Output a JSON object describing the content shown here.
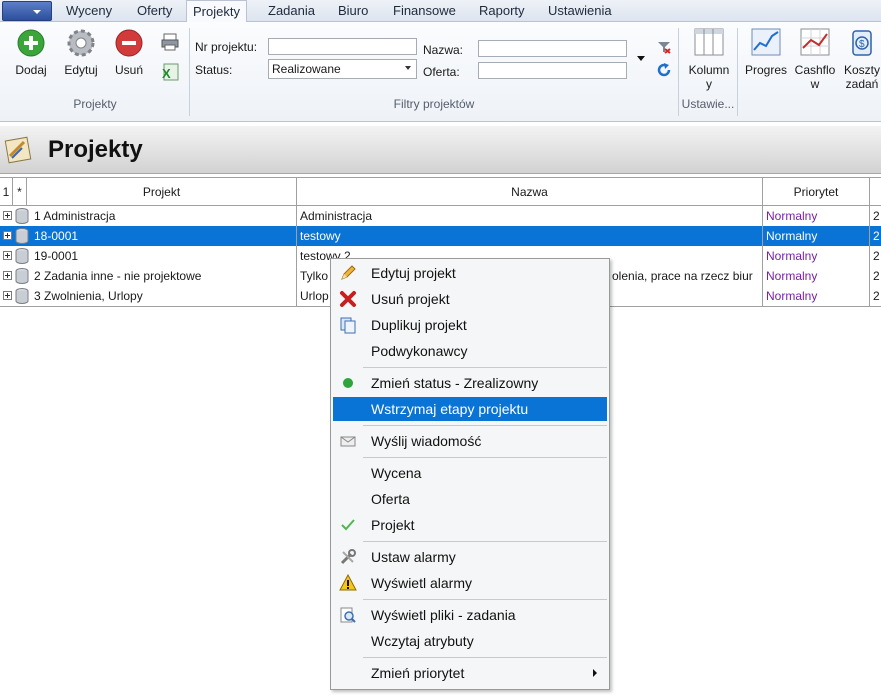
{
  "ribbon_tabs": [
    "Wyceny",
    "Oferty",
    "Projekty",
    "Zadania",
    "Biuro",
    "Finansowe",
    "Raporty",
    "Ustawienia"
  ],
  "ribbon": {
    "projekty_group": {
      "add": "Dodaj",
      "edit": "Edytuj",
      "delete": "Usuń",
      "label": "Projekty"
    },
    "filters": {
      "nr_label": "Nr projektu:",
      "nr_value": "",
      "status_label": "Status:",
      "status_value": "Realizowane",
      "name_label": "Nazwa:",
      "name_value": "",
      "offer_label": "Oferta:",
      "offer_value": "",
      "label": "Filtry projektów"
    },
    "columns": {
      "label_line1": "Kolumn",
      "label_line2": "y",
      "group_label": "Ustawie..."
    },
    "progres": "Progres",
    "cashflow_line1": "Cashflo",
    "cashflow_line2": "w",
    "koszty_line1": "Koszty",
    "koszty_line2": "zadań"
  },
  "page": {
    "title": "Projekty"
  },
  "grid": {
    "headers": {
      "num": "1",
      "star": "*",
      "projekt": "Projekt",
      "nazwa": "Nazwa",
      "priorytet": "Priorytet"
    },
    "rows": [
      {
        "projekt": "1 Administracja",
        "nazwa": "Administracja",
        "priorytet": "Normalny",
        "extra": "2"
      },
      {
        "projekt": "18-0001",
        "nazwa": "testowy",
        "priorytet": "Normalny",
        "extra": "2"
      },
      {
        "projekt": "19-0001",
        "nazwa": "testowy 2",
        "priorytet": "Normalny",
        "extra": "2"
      },
      {
        "projekt": "2 Zadania inne - nie projektowe",
        "nazwa": "Tylko",
        "nazwa_tail": "olenia, prace na rzecz biur",
        "priorytet": "Normalny",
        "extra": "2"
      },
      {
        "projekt": "3 Zwolnienia, Urlopy",
        "nazwa": "Urlop",
        "priorytet": "Normalny",
        "extra": "2"
      }
    ]
  },
  "context_menu": {
    "items": [
      "Edytuj projekt",
      "Usuń projekt",
      "Duplikuj projekt",
      "Podwykonawcy",
      "Zmień status - Zrealizowny",
      "Wstrzymaj etapy projektu",
      "Wyślij wiadomość",
      "Wycena",
      "Oferta",
      "Projekt",
      "Ustaw alarmy",
      "Wyświetl alarmy",
      "Wyświetl pliki - zadania",
      "Wczytaj atrybuty",
      "Zmień priorytet"
    ]
  },
  "colors": {
    "selection": "#0a73d6",
    "priority_text": "#7a1fa8",
    "status_dot": "#2fa43a"
  }
}
